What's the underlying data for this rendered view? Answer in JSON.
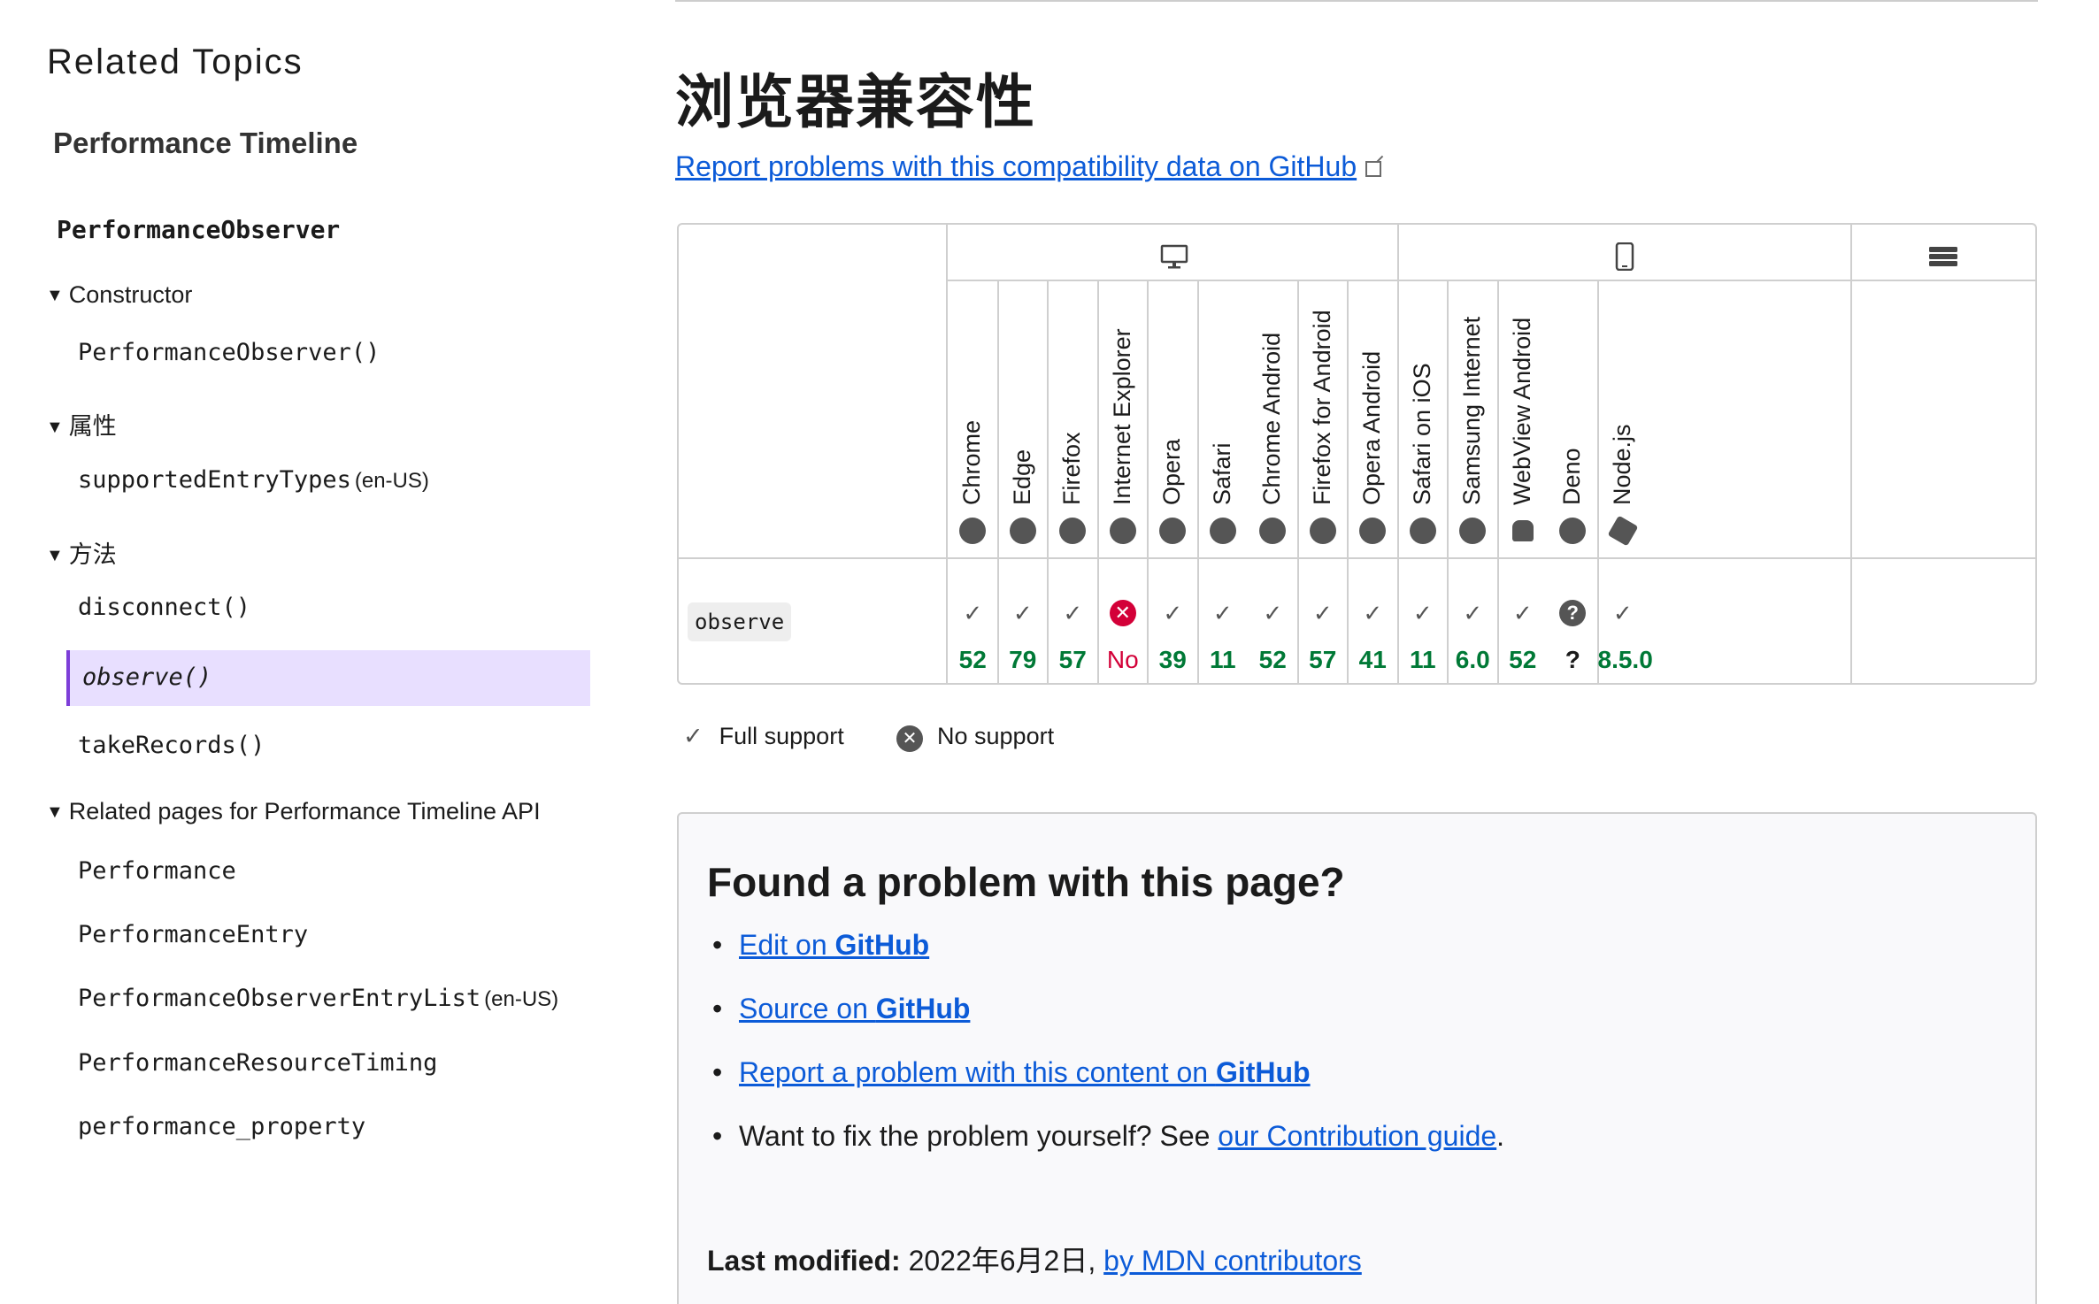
{
  "sidebar": {
    "title": "Related Topics",
    "parent": "Performance Timeline",
    "api": "PerformanceObserver",
    "sections": [
      {
        "toggle": "Constructor",
        "items": [
          {
            "label": "PerformanceObserver()"
          }
        ]
      },
      {
        "toggle": "属性",
        "items": [
          {
            "label": "supportedEntryTypes",
            "lang": "(en-US)"
          }
        ]
      },
      {
        "toggle": "方法",
        "items": [
          {
            "label": "disconnect()"
          },
          {
            "label": "observe()",
            "active": true
          },
          {
            "label": "takeRecords()"
          }
        ]
      },
      {
        "toggle": "Related pages for Performance Timeline API",
        "items": [
          {
            "label": "Performance"
          },
          {
            "label": "PerformanceEntry"
          },
          {
            "label": "PerformanceObserverEntryList",
            "lang": "(en-US)"
          },
          {
            "label": "PerformanceResourceTiming"
          },
          {
            "label": "performance_property"
          }
        ]
      }
    ]
  },
  "main": {
    "heading": "浏览器兼容性",
    "report_link": "Report problems with this compatibility data on GitHub",
    "compat": {
      "groups": [
        {
          "name": "desktop",
          "icon": "desktop-icon"
        },
        {
          "name": "mobile",
          "icon": "mobile-icon"
        },
        {
          "name": "server",
          "icon": "server-icon"
        }
      ],
      "browsers": [
        {
          "name": "Chrome",
          "icon": "chrome-icon"
        },
        {
          "name": "Edge",
          "icon": "edge-icon"
        },
        {
          "name": "Firefox",
          "icon": "firefox-icon"
        },
        {
          "name": "Internet Explorer",
          "icon": "ie-icon"
        },
        {
          "name": "Opera",
          "icon": "opera-icon"
        },
        {
          "name": "Safari",
          "icon": "safari-icon"
        },
        {
          "name": "Chrome Android",
          "icon": "chrome-icon"
        },
        {
          "name": "Firefox for Android",
          "icon": "firefox-icon"
        },
        {
          "name": "Opera Android",
          "icon": "opera-icon"
        },
        {
          "name": "Safari on iOS",
          "icon": "safari-icon"
        },
        {
          "name": "Samsung Internet",
          "icon": "samsung-icon"
        },
        {
          "name": "WebView Android",
          "icon": "android-icon"
        },
        {
          "name": "Deno",
          "icon": "deno-icon"
        },
        {
          "name": "Node.js",
          "icon": "nodejs-icon"
        }
      ],
      "feature": "observe",
      "support": [
        {
          "status": "yes",
          "version": "52"
        },
        {
          "status": "yes",
          "version": "79"
        },
        {
          "status": "yes",
          "version": "57"
        },
        {
          "status": "no",
          "version": "No"
        },
        {
          "status": "yes",
          "version": "39"
        },
        {
          "status": "yes",
          "version": "11"
        },
        {
          "status": "yes",
          "version": "52"
        },
        {
          "status": "yes",
          "version": "57"
        },
        {
          "status": "yes",
          "version": "41"
        },
        {
          "status": "yes",
          "version": "11"
        },
        {
          "status": "yes",
          "version": "6.0"
        },
        {
          "status": "yes",
          "version": "52"
        },
        {
          "status": "unknown",
          "version": "?"
        },
        {
          "status": "yes",
          "version": "8.5.0"
        }
      ]
    },
    "legend": {
      "full": "Full support",
      "none": "No support"
    },
    "feedback": {
      "title": "Found a problem with this page?",
      "edit_pre": "Edit on ",
      "edit_bold": "GitHub",
      "source_pre": "Source on ",
      "source_bold": "GitHub",
      "report_pre": "Report a problem with this content on ",
      "report_bold": "GitHub",
      "fix_text": "Want to fix the problem yourself? See ",
      "fix_link": "our Contribution guide",
      "fix_end": ".",
      "last_modified_label": "Last modified:",
      "last_modified_date": " 2022年6月2日, ",
      "contributors_link": "by MDN contributors"
    }
  },
  "colors": {
    "accent": "#7d3ed8",
    "link": "#0c5bd8",
    "yes": "#007936",
    "no": "#d30038"
  }
}
